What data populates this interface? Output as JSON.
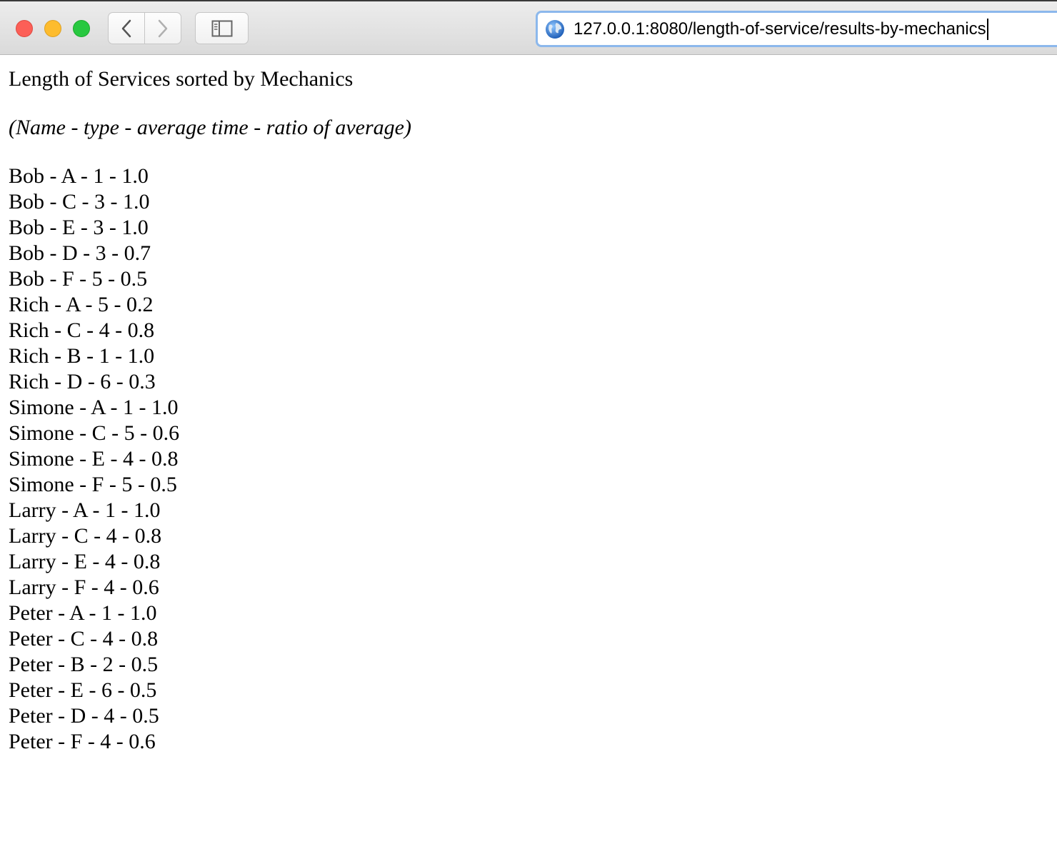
{
  "browser": {
    "url": "127.0.0.1:8080/length-of-service/results-by-mechanics",
    "buttons": {
      "back": "chevron-left-icon",
      "forward": "chevron-right-icon",
      "sidebar": "sidebar-icon"
    },
    "colors": {
      "close": "#fc5f57",
      "minimize": "#fdbc2e",
      "zoom": "#28c840",
      "url_focus": "#8cb8ec"
    }
  },
  "page": {
    "heading": "Length of Services sorted by Mechanics",
    "subheading": "(Name - type - average time - ratio of average)",
    "results": [
      "Bob - A - 1 - 1.0",
      "Bob - C - 3 - 1.0",
      "Bob - E - 3 - 1.0",
      "Bob - D - 3 - 0.7",
      "Bob - F - 5 - 0.5",
      "Rich - A - 5 - 0.2",
      "Rich - C - 4 - 0.8",
      "Rich - B - 1 - 1.0",
      "Rich - D - 6 - 0.3",
      "Simone - A - 1 - 1.0",
      "Simone - C - 5 - 0.6",
      "Simone - E - 4 - 0.8",
      "Simone - F - 5 - 0.5",
      "Larry - A - 1 - 1.0",
      "Larry - C - 4 - 0.8",
      "Larry - E - 4 - 0.8",
      "Larry - F - 4 - 0.6",
      "Peter - A - 1 - 1.0",
      "Peter - C - 4 - 0.8",
      "Peter - B - 2 - 0.5",
      "Peter - E - 6 - 0.5",
      "Peter - D - 4 - 0.5",
      "Peter - F - 4 - 0.6"
    ]
  }
}
